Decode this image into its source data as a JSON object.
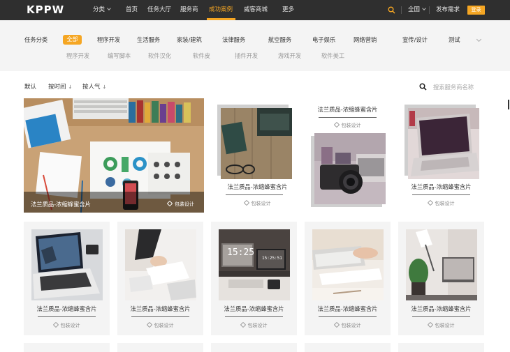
{
  "brand": {
    "logo": "KPPW",
    "accent": "#f5a623",
    "topbar_bg": "#2f2f2f"
  },
  "topnav": {
    "items": [
      {
        "label": "分类",
        "has_chevron": true
      },
      {
        "label": "首页"
      },
      {
        "label": "任务大厅"
      },
      {
        "label": "服务商"
      },
      {
        "label": "成功案例",
        "active": true
      },
      {
        "label": "威客商城"
      },
      {
        "label": "更多"
      }
    ],
    "region": "全国",
    "post_task": "发布需求",
    "login": "登录",
    "search_icon": "search-icon"
  },
  "filter": {
    "label": "任务分类",
    "all": "全部",
    "categories": [
      "程序开发",
      "生活服务",
      "家装/建筑",
      "法律服务",
      "航空服务",
      "电子娱乐",
      "网络营销",
      "宣传/设计",
      "测试"
    ],
    "subcategories": [
      "程序开发",
      "编写脚本",
      "软件汉化",
      "软件皮",
      "插件开发",
      "游戏开发",
      "软件美工"
    ],
    "more_icon": "chevron-down-icon"
  },
  "sort": {
    "options": [
      {
        "label": "默认"
      },
      {
        "label": "按时间",
        "arrow": "↓"
      },
      {
        "label": "按人气",
        "arrow": "↓"
      }
    ],
    "search_placeholder": "搜索服务商名称"
  },
  "cards": {
    "featured": {
      "title": "法兰质品-浓缩蜂蜜含片",
      "tag": "包装设计"
    },
    "row1": [
      {
        "title": "法兰质品-浓缩蜂蜜含片",
        "tag": "包装设计"
      },
      {
        "title": "法兰质品-浓缩蜂蜜含片",
        "tag": "包装设计"
      },
      {
        "title": "法兰质品-浓缩蜂蜜含片",
        "tag": "包装设计"
      }
    ],
    "row2": [
      {
        "title": "法兰质品-浓缩蜂蜜含片",
        "tag": "包装设计"
      },
      {
        "title": "法兰质品-浓缩蜂蜜含片",
        "tag": "包装设计"
      },
      {
        "title": "法兰质品-浓缩蜂蜜含片",
        "tag": "包装设计"
      },
      {
        "title": "法兰质品-浓缩蜂蜜含片",
        "tag": "包装设计"
      },
      {
        "title": "法兰质品-浓缩蜂蜜含片",
        "tag": "包装设计"
      }
    ]
  }
}
